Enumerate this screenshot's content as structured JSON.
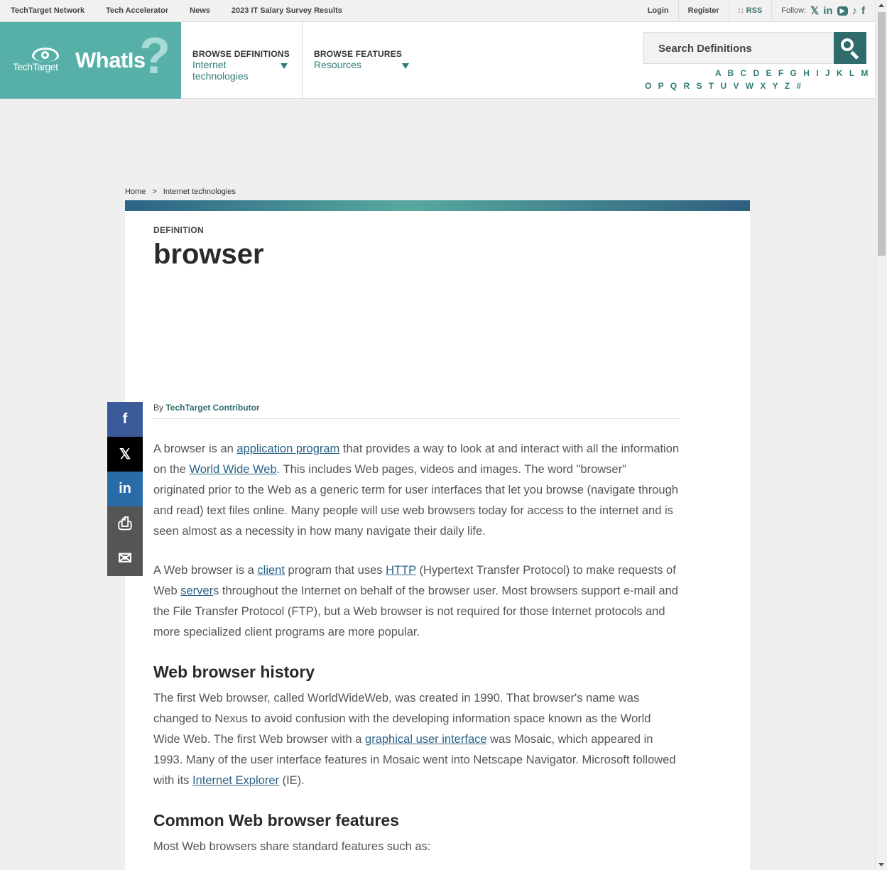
{
  "topbar": {
    "links": [
      "TechTarget Network",
      "Tech Accelerator",
      "News",
      "2023 IT Salary Survey Results"
    ],
    "login": "Login",
    "register": "Register",
    "rss": "RSS",
    "follow": "Follow:"
  },
  "header": {
    "logo_brand": "TechTarget",
    "logo_product": "WhatIs",
    "nav": [
      {
        "title": "BROWSE DEFINITIONS",
        "value": "Internet technologies"
      },
      {
        "title": "BROWSE FEATURES",
        "value": "Resources"
      }
    ],
    "search_placeholder": "Search Definitions",
    "alphabet_row1": "A B C D E F G H I J K L M N",
    "alphabet_row2": "O P Q R S T U V W X Y Z #"
  },
  "breadcrumb": [
    "Home",
    ">",
    "Internet technologies"
  ],
  "article": {
    "kicker": "DEFINITION",
    "title": "browser",
    "byline_prefix": "By",
    "author": "TechTarget Contributor",
    "p1": {
      "t1": "A browser is an ",
      "l1": "application program",
      "t2": " that provides a way to look at and interact with all the information on the ",
      "l2": "World Wide Web",
      "t3": ". This includes Web pages, videos and images. The word \"browser\" originated prior to the Web as a generic term for user interfaces that let you browse (navigate through and read) text files online. Many people will use web browsers today for access to the internet and is seen almost as a necessity in how many navigate their daily life."
    },
    "p2": {
      "t1": "A Web browser is a ",
      "l1": "client",
      "t2": " program that uses ",
      "l2": "HTTP",
      "t3": " (Hypertext Transfer Protocol) to make requests of Web ",
      "l3": "server",
      "t4": "s throughout the Internet on behalf of the browser user. Most browsers support e-mail and the File Transfer Protocol (FTP), but a Web browser is not required for those Internet protocols and more specialized client programs are more popular."
    },
    "h2_history": "Web browser history",
    "p3": {
      "t1": "The first Web browser, called WorldWideWeb, was created in 1990. That browser's name was changed to Nexus to avoid confusion with the developing information space known as the World Wide Web. The first Web browser with a ",
      "l1": "graphical user interface",
      "t2": " was Mosaic, which appeared in 1993. Many of the user interface features in Mosaic went into Netscape Navigator. Microsoft followed with its ",
      "l2": "Internet Explorer",
      "t3": " (IE)."
    },
    "h2_features": "Common Web browser features",
    "p4": "Most Web browsers share standard features such as:"
  },
  "share": {
    "facebook": "f",
    "x": "𝕏",
    "linkedin": "in",
    "print": "⎙",
    "email": "✉"
  }
}
